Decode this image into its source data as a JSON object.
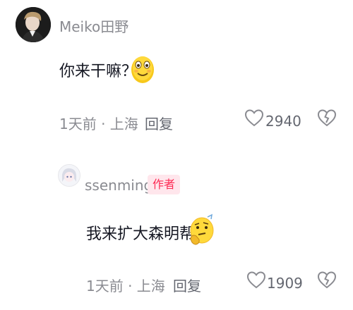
{
  "colors": {
    "primary_text": "#161823",
    "secondary_text": "#8a8b91",
    "author_badge_text": "#fe2c55",
    "author_badge_bg": "#ffe6ec"
  },
  "comments": [
    {
      "username": "Meiko田野",
      "text": "你来干嘛？",
      "emoji": "smiling-face-emoji",
      "time_location": "1天前 · 上海",
      "reply_label": "回复",
      "likes": "2940",
      "avatar": "user-avatar-photo"
    },
    {
      "username": "ssenming",
      "badge": "作者",
      "text": "我来扩大森明帮",
      "emoji": "thinking-face-emoji",
      "time_location": "1天前 · 上海",
      "reply_label": "回复",
      "likes": "1909",
      "avatar": "anime-avatar"
    }
  ]
}
